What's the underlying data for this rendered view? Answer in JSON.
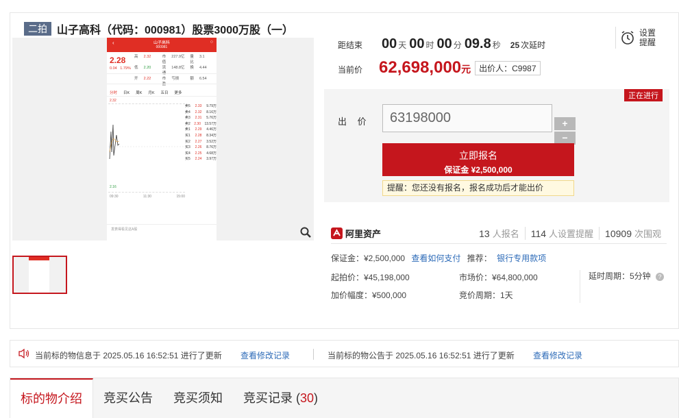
{
  "header": {
    "round_tag": "二拍",
    "title": "山子高科（代码：000981）股票3000万股（一）"
  },
  "phone": {
    "app_title": "山子高科",
    "code_line": "000981",
    "price": "2.28",
    "change": "0.04",
    "change_pct": "1.79%",
    "stats": [
      [
        "高",
        "2.32",
        "市值",
        "227.9亿",
        "量比",
        "3.1"
      ],
      [
        "低",
        "2.20",
        "流通",
        "148.8亿",
        "换",
        "4.44"
      ],
      [
        "开",
        "2.22",
        "市盈",
        "亏损",
        "额",
        "6.54"
      ]
    ],
    "tabs": [
      "分时",
      "日K",
      "周K",
      "月K",
      "五日",
      "更多"
    ],
    "book": [
      [
        "卖5",
        "2.33",
        "9.79万"
      ],
      [
        "卖4",
        "2.32",
        "8.16万"
      ],
      [
        "卖3",
        "2.31",
        "5.76万"
      ],
      [
        "卖2",
        "2.30",
        "13.57万"
      ],
      [
        "卖1",
        "2.29",
        "4.46万"
      ],
      [
        "买1",
        "2.28",
        "8.34万"
      ],
      [
        "买2",
        "2.27",
        "3.52万"
      ],
      [
        "买3",
        "2.26",
        "8.76万"
      ],
      [
        "买4",
        "2.25",
        "4.68万"
      ],
      [
        "买5",
        "2.24",
        "3.97万"
      ]
    ],
    "chart_hi": "2.32",
    "chart_lo": "2.16",
    "time_start": "09:30",
    "time_mid": "11:30",
    "time_end": "15:00",
    "bottom_hint": "发表得看见这A股"
  },
  "countdown": {
    "label": "距结束",
    "days": "00",
    "days_unit": "天",
    "hours": "00",
    "hours_unit": "时",
    "minutes": "00",
    "minutes_unit": "分",
    "seconds": "09.8",
    "seconds_unit": "秒",
    "delays": "25",
    "delays_text": "次延时"
  },
  "reminder": {
    "label": "设置提醒"
  },
  "current": {
    "label": "当前价",
    "price": "62,698,000",
    "unit": "元",
    "bidder": "出价人：C9987"
  },
  "bid": {
    "status": "正在进行",
    "label": "出 价",
    "input_value": "63198000",
    "plus": "+",
    "minus": "−",
    "signup_label": "立即报名",
    "deposit_label": "保证金 ¥2,500,000",
    "tip": "提醒：您还没有报名，报名成功后才能出价"
  },
  "seller": {
    "name": "阿里资产",
    "signups_count": "13",
    "signups_text": "人报名",
    "reminders_count": "114",
    "reminders_text": "人设置提醒",
    "views_count": "10909",
    "views_text": "次围观"
  },
  "details": {
    "deposit": "保证金：¥2,500,000",
    "how_to_pay": "查看如何支付",
    "recommend": "推荐：",
    "bank_link": "银行专用款项",
    "start_price": "起拍价：¥45,198,000",
    "market_price": "市场价：¥64,800,000",
    "delay_period": "延时周期：5分钟",
    "increment": "加价幅度：¥500,000",
    "bid_period": "竞价周期：1天"
  },
  "notice": {
    "item_update": "当前标的物信息于 2025.05.16 16:52:51 进行了更新",
    "item_link": "查看修改记录",
    "announce_update": "当前标的物公告于 2025.05.16 16:52:51 进行了更新",
    "announce_link": "查看修改记录"
  },
  "tabs": {
    "intro": "标的物介绍",
    "announcement": "竞买公告",
    "notice": "竞买须知",
    "records": "竞买记录",
    "records_count": "30"
  }
}
